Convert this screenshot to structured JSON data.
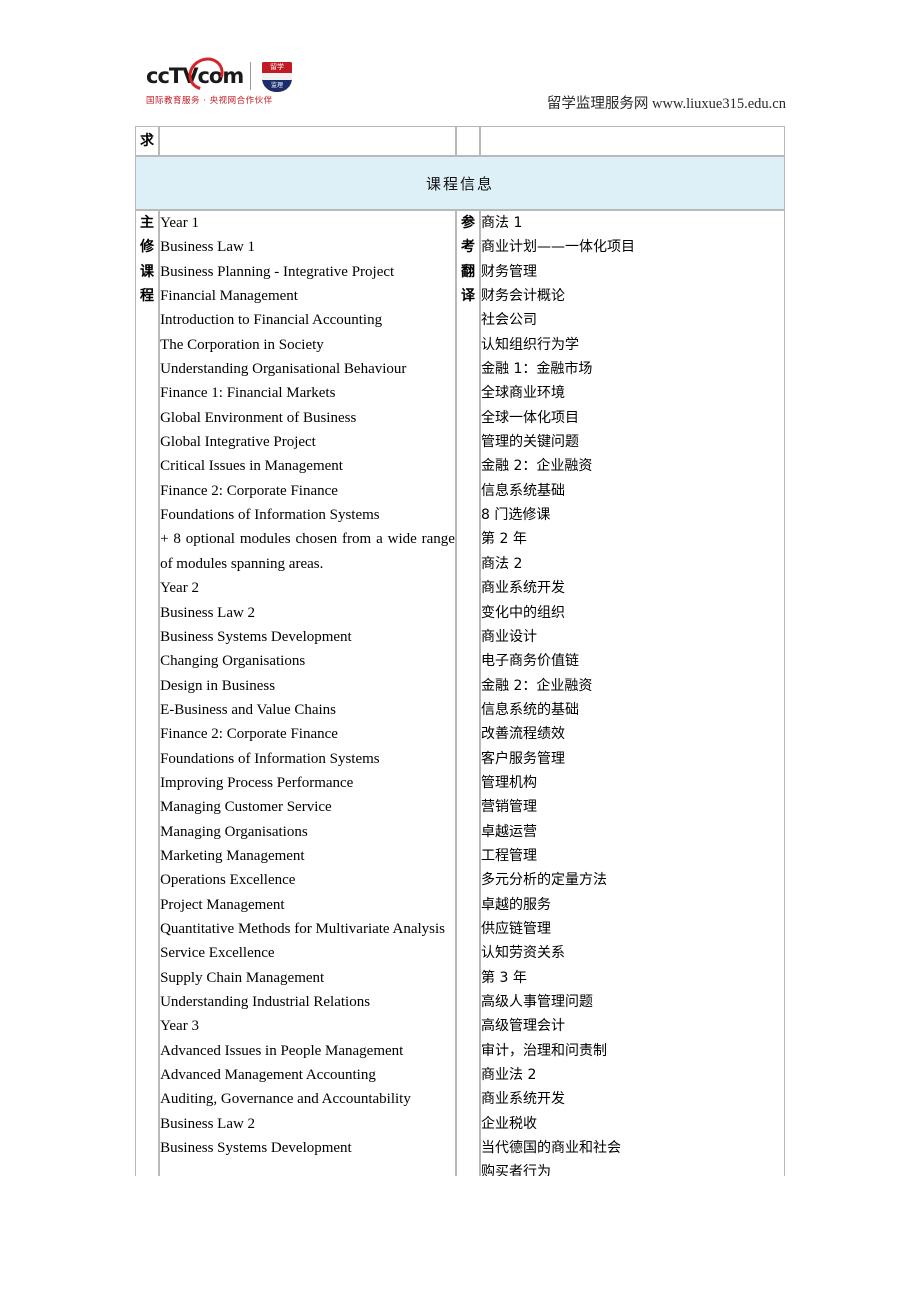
{
  "header": {
    "logo": {
      "wordmark": "ccTV",
      "wordmark_suffix": "com",
      "badge_top": "留学",
      "badge_bottom": "监理",
      "tagline": "国际教育服务 · 央视网合作伙伴"
    },
    "site_name": "留学监理服务网",
    "site_url": "www.liuxue315.edu.cn"
  },
  "table": {
    "stub_label": "求",
    "banner_title": "课程信息",
    "row_label_main": [
      "主",
      "修",
      "课",
      "程"
    ],
    "row_label_translation": [
      "参",
      "考",
      "翻",
      "译"
    ],
    "courses_en": [
      "Year 1",
      "Business Law 1",
      "Business Planning  - Integrative Project",
      "Financial Management",
      "Introduction to Financial Accounting",
      "The Corporation in Society",
      "Understanding Organisational Behaviour",
      "Finance 1: Financial Markets",
      "Global Environment of Business",
      "Global Integrative Project",
      "Critical Issues in Management",
      "Finance 2: Corporate Finance",
      "Foundations of Information Systems",
      "+ 8 optional modules chosen from a wide range of modules spanning areas.",
      "Year 2",
      "Business Law 2",
      "Business Systems Development",
      "Changing Organisations",
      "Design in Business",
      "E-Business and Value Chains",
      "Finance 2: Corporate Finance",
      "Foundations of Information Systems",
      "Improving Process Performance",
      "Managing Customer Service",
      "Managing Organisations",
      "Marketing Management",
      "Operations Excellence",
      "Project Management",
      "Quantitative Methods for Multivariate Analysis",
      "Service Excellence",
      "Supply Chain Management",
      "Understanding Industrial Relations",
      "Year 3",
      "Advanced Issues in People Management",
      "Advanced Management Accounting",
      "Auditing, Governance and Accountability",
      "Business Law 2",
      "Business Systems Development"
    ],
    "courses_en_wrap_index": 13,
    "courses_en_wrap_index2": 28,
    "courses_zh": [
      "商法 1",
      "商业计划——一体化项目",
      "财务管理",
      "财务会计概论",
      "社会公司",
      "认知组织行为学",
      "金融 1：金融市场",
      "全球商业环境",
      "全球一体化项目",
      "管理的关键问题",
      "金融 2：企业融资",
      "信息系统基础",
      "8 门选修课",
      "第 2 年",
      "商法 2",
      "商业系统开发",
      "变化中的组织",
      "商业设计",
      "电子商务价值链",
      "金融 2：企业融资",
      "信息系统的基础",
      "改善流程绩效",
      "客户服务管理",
      "管理机构",
      "营销管理",
      "卓越运营",
      "工程管理",
      "多元分析的定量方法",
      "卓越的服务",
      "供应链管理",
      "认知劳资关系",
      "第 3 年",
      "高级人事管理问题",
      "高级管理会计",
      "审计，治理和问责制",
      "商业法 2",
      "商业系统开发",
      "企业税收",
      "当代德国的商业和社会",
      "购买者行为"
    ]
  },
  "colors": {
    "banner_bg": "#ddeff7",
    "border": "#b9b9b9",
    "logo_red": "#c21a22",
    "badge_navy": "#1b2d6b"
  }
}
